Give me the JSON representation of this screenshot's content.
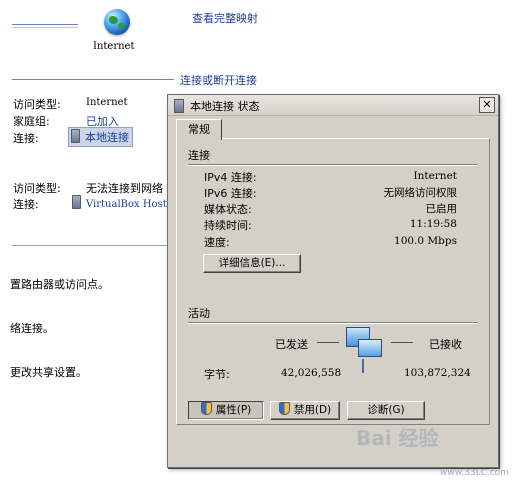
{
  "background": {
    "network_label": "Internet",
    "view_full_map": "查看完整映射",
    "connect_disconnect": "连接或断开连接",
    "network1": {
      "access_type_label": "访问类型:",
      "access_type_value": "Internet",
      "homegroup_label": "家庭组:",
      "homegroup_value": "已加入",
      "connection_label": "连接:",
      "connection_value": "本地连接"
    },
    "network2": {
      "access_type_label": "访问类型:",
      "access_type_value": "无法连接到网络",
      "connection_label": "连接:",
      "connection_value": "VirtualBox Host"
    },
    "task1": "置路由器或访问点。",
    "task2": "络连接。",
    "task3": "更改共享设置。"
  },
  "dialog": {
    "title": "本地连接 状态",
    "close_glyph": "✕",
    "tab_general": "常规",
    "connection": {
      "section": "连接",
      "rows": [
        {
          "label": "IPv4 连接:",
          "value": "Internet"
        },
        {
          "label": "IPv6 连接:",
          "value": "无网络访问权限"
        },
        {
          "label": "媒体状态:",
          "value": "已启用"
        },
        {
          "label": "持续时间:",
          "value": "11:19:58"
        },
        {
          "label": "速度:",
          "value": "100.0 Mbps"
        }
      ],
      "details_button": "详细信息(E)..."
    },
    "activity": {
      "section": "活动",
      "sent_label": "已发送",
      "received_label": "已接收",
      "bytes_label": "字节:",
      "sent_value": "42,026,558",
      "received_value": "103,872,324"
    },
    "buttons": {
      "properties": "属性(P)",
      "disable": "禁用(D)",
      "diagnose": "诊断(G)"
    }
  },
  "watermark": {
    "text": "Bai 经验",
    "site": "www.33LC.com"
  }
}
